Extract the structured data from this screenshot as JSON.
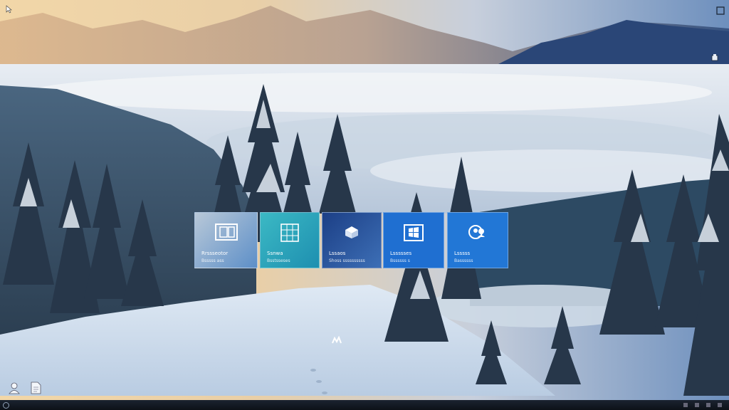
{
  "desktop": {
    "wallpaper": "snowy mountain forest with sea of clouds",
    "colors": {
      "tile_blue": "#1f6fd1",
      "tile_teal": "#27a3b4",
      "tile_navy": "#2b4f8e"
    }
  },
  "tiles": [
    {
      "label": "Rrssseotor",
      "sub": "Bsssss ass",
      "icon": "window-icon"
    },
    {
      "label": "Ssnwa",
      "sub": "Bsstsseses",
      "icon": "calendar-grid-icon"
    },
    {
      "label": "Lssaos",
      "sub": "Shoss ssssssssss",
      "icon": "box-icon"
    },
    {
      "label": "Lssssses",
      "sub": "Bssssss s",
      "icon": "windows-logo-icon"
    },
    {
      "label": "Lsssss",
      "sub": "Bassssss",
      "icon": "people-icon"
    }
  ],
  "desktop_icons": [
    {
      "icon": "person-icon"
    },
    {
      "icon": "document-icon"
    }
  ],
  "corner_icons": [
    {
      "icon": "cursor-icon"
    },
    {
      "icon": "restore-icon"
    },
    {
      "icon": "app-icon"
    }
  ]
}
